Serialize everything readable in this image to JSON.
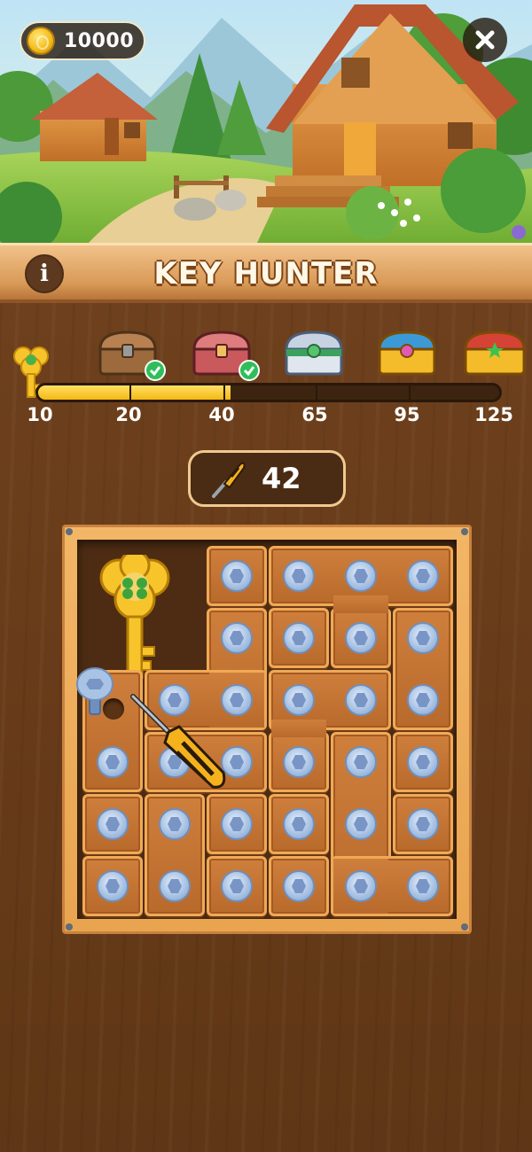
{
  "header": {
    "coin_balance": "10000",
    "title": "KEY HUNTER",
    "info_label": "i"
  },
  "progress": {
    "milestones": [
      "10",
      "20",
      "40",
      "65",
      "95",
      "125"
    ],
    "current_value": 42,
    "max_value": 125,
    "rewards": [
      {
        "icon": "wooden-chest-icon",
        "claimed": true
      },
      {
        "icon": "red-chest-icon",
        "claimed": true
      },
      {
        "icon": "silver-chest-icon",
        "claimed": false
      },
      {
        "icon": "gold-chest-icon",
        "claimed": false
      },
      {
        "icon": "golden-jeweled-chest-icon",
        "claimed": false
      }
    ]
  },
  "counter": {
    "value": "42",
    "icon": "screwdriver-icon"
  },
  "board": {
    "rows": 6,
    "cols": 6,
    "key_icon": "clover-key-icon",
    "tool_icon": "screwdriver-icon"
  },
  "colors": {
    "wood_dark": "#6a3f1c",
    "banner": "#e2a45e",
    "progress_fill": "#f4b813",
    "bolt": "#a9c3e4",
    "check": "#2fbf5a"
  }
}
